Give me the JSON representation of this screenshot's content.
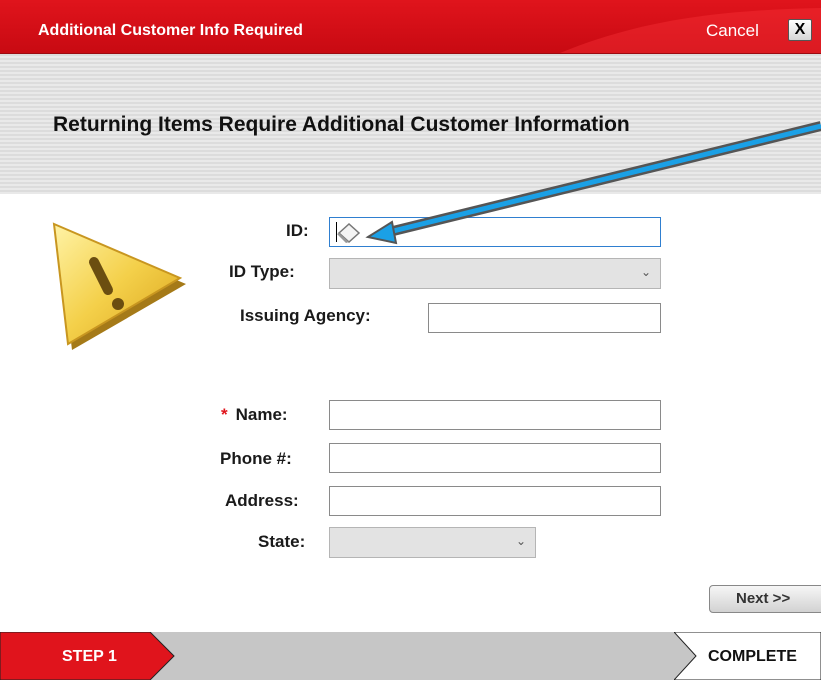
{
  "dialog": {
    "title": "Additional Customer Info Required",
    "cancel_label": "Cancel",
    "close_glyph": "X",
    "heading": "Returning Items Require Additional Customer Information"
  },
  "form": {
    "id_label": "ID:",
    "id_type_label": "ID Type:",
    "issuing_agency_label": "Issuing Agency:",
    "name_required_marker": "*",
    "name_label": "Name:",
    "phone_label": "Phone #:",
    "address_label": "Address:",
    "state_label": "State:"
  },
  "buttons": {
    "next_label": "Next >>"
  },
  "steps": {
    "step1": "STEP 1",
    "complete": "COMPLETE"
  },
  "colors": {
    "brand_red": "#e0141c",
    "focus_blue": "#2f7fd0",
    "annotation_arrow": "#1aa0e6"
  },
  "icons": [
    "warning-triangle-icon",
    "chevron-down-icon",
    "close-icon",
    "cursor-icon"
  ]
}
